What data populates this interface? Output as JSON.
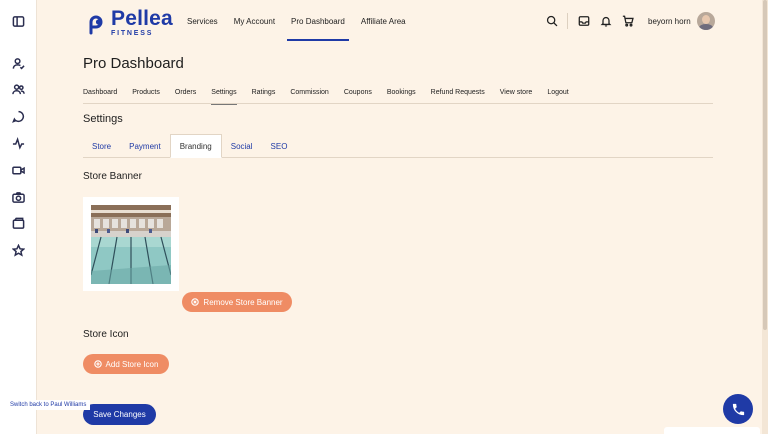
{
  "brand": {
    "name": "Pellea",
    "tagline": "FITNESS",
    "color": "#1f3aa6",
    "accent": "#ef8c64"
  },
  "sidebar": {
    "icons": [
      "panel-toggle-icon",
      "user-check-icon",
      "users-icon",
      "chat-icon",
      "activity-icon",
      "video-icon",
      "camera-icon",
      "wallet-icon",
      "star-icon"
    ]
  },
  "topnav": {
    "items": [
      {
        "label": "Services"
      },
      {
        "label": "My Account"
      },
      {
        "label": "Pro Dashboard",
        "active": true
      },
      {
        "label": "Affiliate Area"
      }
    ]
  },
  "header": {
    "icons": [
      "search-icon",
      "inbox-icon",
      "bell-icon",
      "cart-icon"
    ],
    "user_name": "beyorn horn"
  },
  "page": {
    "title": "Pro Dashboard"
  },
  "subnav": {
    "items": [
      {
        "label": "Dashboard"
      },
      {
        "label": "Products"
      },
      {
        "label": "Orders"
      },
      {
        "label": "Settings",
        "active": true
      },
      {
        "label": "Ratings"
      },
      {
        "label": "Commission"
      },
      {
        "label": "Coupons"
      },
      {
        "label": "Bookings"
      },
      {
        "label": "Refund Requests"
      },
      {
        "label": "View store"
      },
      {
        "label": "Logout"
      }
    ]
  },
  "settings": {
    "title": "Settings",
    "tabs": [
      {
        "label": "Store"
      },
      {
        "label": "Payment"
      },
      {
        "label": "Branding",
        "active": true
      },
      {
        "label": "Social"
      },
      {
        "label": "SEO"
      }
    ]
  },
  "branding": {
    "banner_heading": "Store Banner",
    "remove_banner_label": "Remove Store Banner",
    "icon_heading": "Store Icon",
    "add_icon_label": "Add Store Icon",
    "save_label": "Save Changes"
  },
  "switch_back": "Switch back to Paul Williams"
}
